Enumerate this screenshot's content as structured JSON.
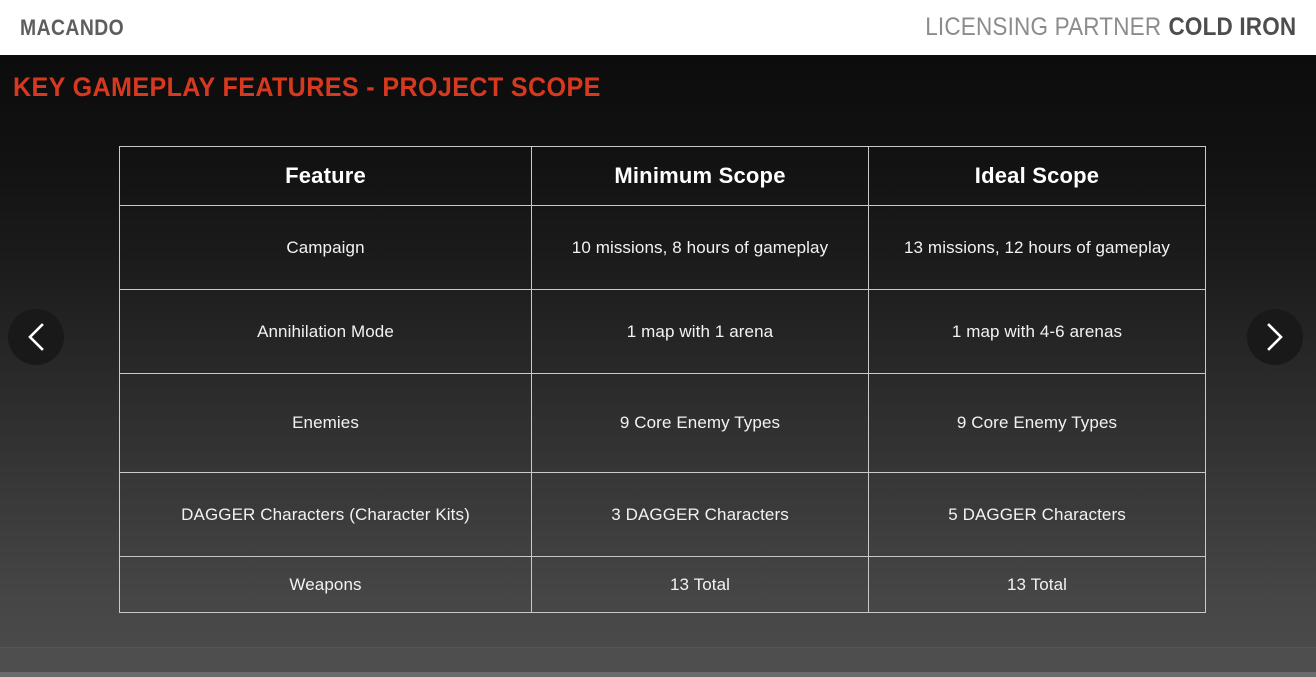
{
  "brand": {
    "logo": "MACANDO",
    "partner_label": "LICENSING PARTNER",
    "partner_name": "COLD IRON"
  },
  "slide": {
    "title": "KEY GAMEPLAY FEATURES - PROJECT SCOPE",
    "title_color": "#d6391f",
    "background_top": "#0c0c0c",
    "background_bottom": "#4a4a4a"
  },
  "table": {
    "headers": [
      "Feature",
      "Minimum Scope",
      "Ideal Scope"
    ],
    "rows": [
      {
        "feature": "Campaign",
        "minimum": "10 missions, 8 hours of gameplay",
        "ideal": "13 missions, 12 hours of gameplay"
      },
      {
        "feature": "Annihilation Mode",
        "minimum": "1 map with 1 arena",
        "ideal": "1 map with 4-6 arenas"
      },
      {
        "feature": "Enemies",
        "minimum": "9 Core Enemy Types",
        "ideal": "9 Core Enemy Types"
      },
      {
        "feature": "DAGGER Characters (Character Kits)",
        "minimum": "3 DAGGER Characters",
        "ideal": "5 DAGGER Characters"
      },
      {
        "feature": "Weapons",
        "minimum": "13 Total",
        "ideal": "13 Total"
      }
    ]
  },
  "carousel": {
    "previous_icon": "chevron-left-icon",
    "next_icon": "chevron-right-icon"
  }
}
